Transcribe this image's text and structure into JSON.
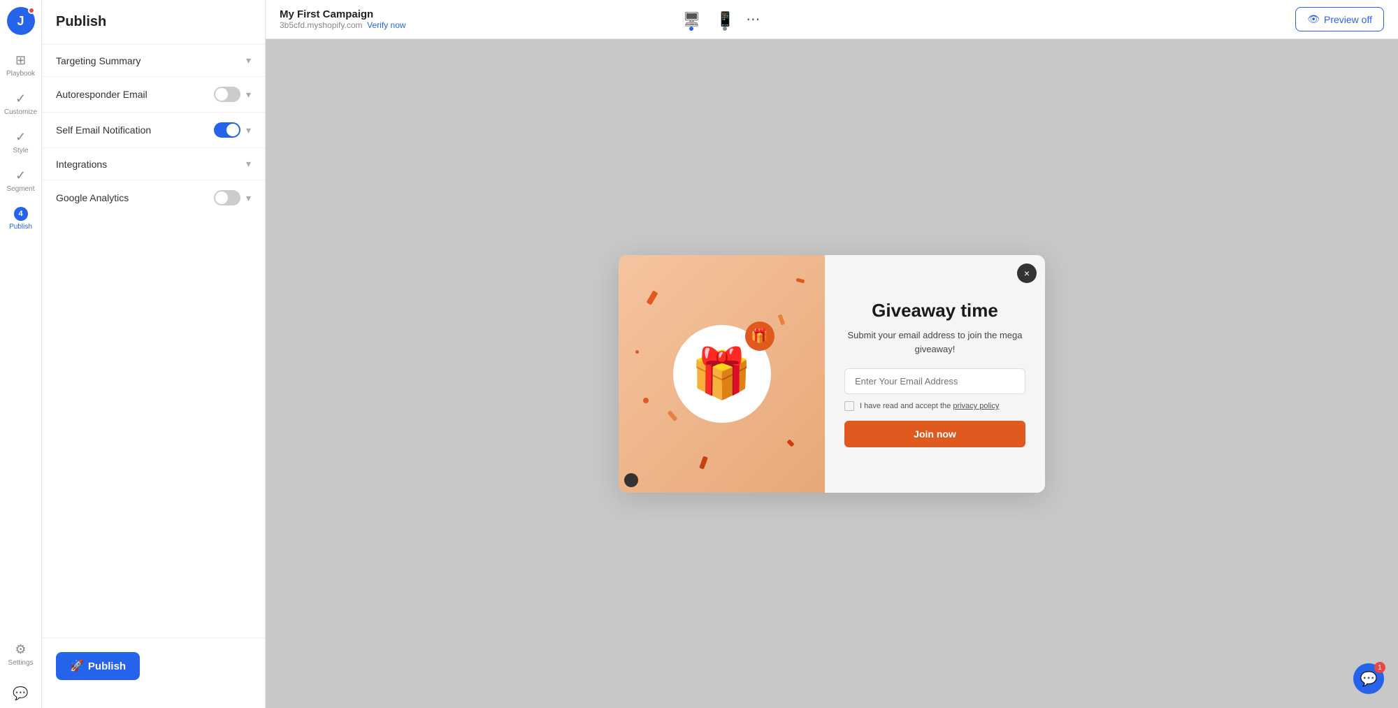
{
  "sidebar": {
    "logo_label": "J",
    "nav_items": [
      {
        "id": "playbook",
        "label": "Playbook",
        "icon": "⊞",
        "active": false
      },
      {
        "id": "customize",
        "label": "Customize",
        "icon": "✓",
        "active": false
      },
      {
        "id": "style",
        "label": "Style",
        "icon": "✓",
        "active": false
      },
      {
        "id": "segment",
        "label": "Segment",
        "icon": "✓",
        "active": false
      },
      {
        "id": "publish",
        "label": "Publish",
        "icon": "4",
        "active": true
      }
    ],
    "settings_label": "Settings"
  },
  "panel": {
    "title": "Publish",
    "sections": [
      {
        "id": "targeting-summary",
        "label": "Targeting Summary",
        "toggle": null,
        "toggle_state": null
      },
      {
        "id": "autoresponder-email",
        "label": "Autoresponder Email",
        "toggle": true,
        "toggle_state": "off"
      },
      {
        "id": "self-email-notification",
        "label": "Self Email Notification",
        "toggle": true,
        "toggle_state": "on"
      },
      {
        "id": "integrations",
        "label": "Integrations",
        "toggle": null,
        "toggle_state": null
      },
      {
        "id": "google-analytics",
        "label": "Google Analytics",
        "toggle": true,
        "toggle_state": "off"
      }
    ],
    "publish_btn_label": "Publish",
    "publish_btn_icon": "🚀"
  },
  "topbar": {
    "campaign_name": "My First Campaign",
    "domain": "3b5cfd.myshopify.com",
    "verify_link": "Verify now",
    "preview_btn_label": "Preview off",
    "preview_btn_icon": "👁"
  },
  "popup": {
    "title": "Giveaway time",
    "subtitle": "Submit your email address to join the mega giveaway!",
    "email_placeholder": "Enter Your Email Address",
    "checkbox_label": "I have read and accept the ",
    "privacy_link": "privacy policy",
    "join_btn_label": "Join now",
    "close_label": "×",
    "gift_icon": "🎁"
  },
  "chat": {
    "badge": "1"
  }
}
